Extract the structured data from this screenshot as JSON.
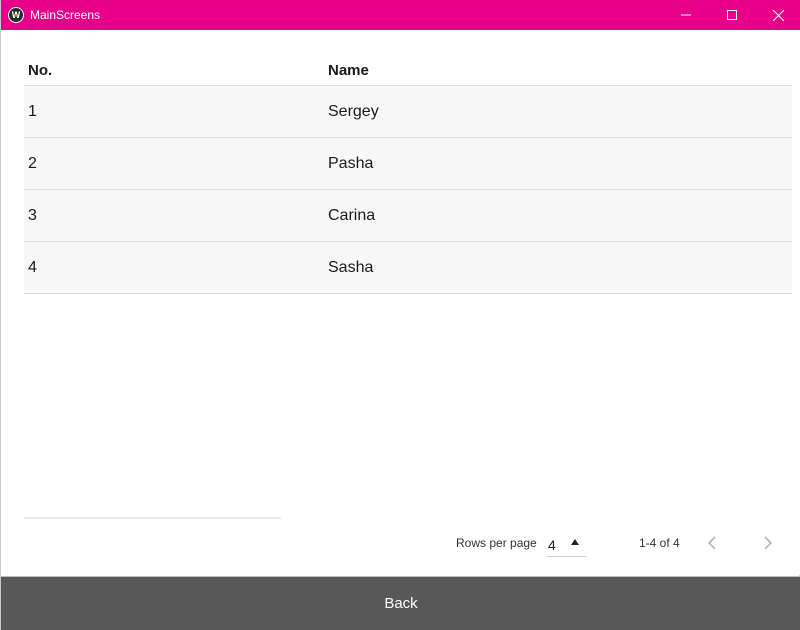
{
  "window": {
    "title": "MainScreens",
    "app_icon_glyph": "W"
  },
  "colors": {
    "titlebar": "#e6008a",
    "back_bar": "#585858"
  },
  "table": {
    "headers": {
      "no": "No.",
      "name": "Name"
    },
    "rows": [
      {
        "no": "1",
        "name": "Sergey"
      },
      {
        "no": "2",
        "name": "Pasha"
      },
      {
        "no": "3",
        "name": "Carina"
      },
      {
        "no": "4",
        "name": "Sasha"
      }
    ]
  },
  "pagination": {
    "rows_per_page_label": "Rows per page",
    "rows_per_page_value": "4",
    "range_label": "1-4 of 4",
    "prev_icon": "chevron-left-icon",
    "next_icon": "chevron-right-icon"
  },
  "footer": {
    "back_label": "Back"
  }
}
